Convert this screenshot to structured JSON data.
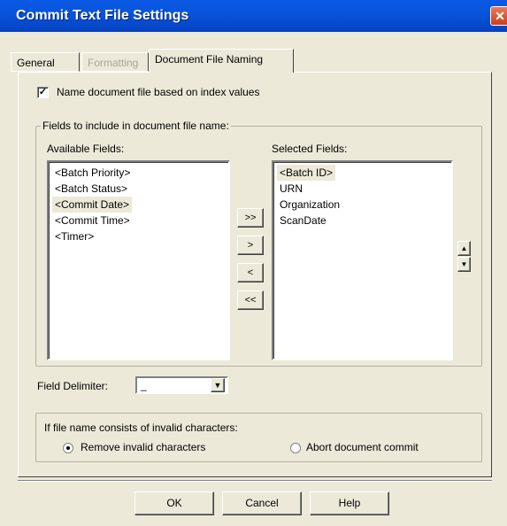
{
  "window": {
    "title": "Commit Text File Settings",
    "close_glyph": "✕"
  },
  "tabs": [
    {
      "label": "General",
      "state": "normal"
    },
    {
      "label": "Formatting",
      "state": "disabled"
    },
    {
      "label": "Document File Naming",
      "state": "active"
    }
  ],
  "naming_checkbox": {
    "label": "Name document file based on index values",
    "checked": true,
    "mark": "✓"
  },
  "fields_group": {
    "legend": "Fields to include in document file name:",
    "available_label": "Available Fields:",
    "available_fields": [
      {
        "text": "<Batch Priority>",
        "selected": false
      },
      {
        "text": "<Batch Status>",
        "selected": false
      },
      {
        "text": "<Commit Date>",
        "selected": true
      },
      {
        "text": "<Commit Time>",
        "selected": false
      },
      {
        "text": "<Timer>",
        "selected": false
      }
    ],
    "selected_label": "Selected Fields:",
    "selected_fields": [
      {
        "text": "<Batch ID>",
        "selected": true
      },
      {
        "text": "URN",
        "selected": false
      },
      {
        "text": "Organization",
        "selected": false
      },
      {
        "text": "ScanDate",
        "selected": false
      }
    ],
    "transfer_buttons": {
      "add_all": ">>",
      "add": ">",
      "remove": "<",
      "remove_all": "<<"
    },
    "order_buttons": {
      "up": "▲",
      "down": "▼"
    }
  },
  "delimiter": {
    "label": "Field Delimiter:",
    "value": "_",
    "arrow": "▼"
  },
  "invalid_chars_group": {
    "legend": "If file name consists of invalid characters:",
    "options": [
      {
        "label": "Remove invalid characters",
        "selected": true
      },
      {
        "label": "Abort document commit",
        "selected": false
      }
    ]
  },
  "buttons": {
    "ok": "OK",
    "cancel": "Cancel",
    "help": "Help"
  },
  "colors": {
    "titlebar": "#0854dc",
    "face": "#ece9d8",
    "close": "#c8411c"
  }
}
